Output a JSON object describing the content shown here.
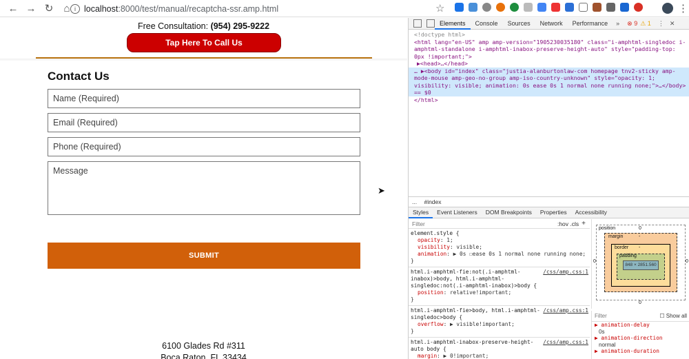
{
  "browser": {
    "url_host": "localhost",
    "url_path": ":8000/test/manual/recaptcha-ssr.amp.html"
  },
  "page": {
    "consult_prefix": "Free Consultation:",
    "consult_phone": "(954) 295-9222",
    "call_button": "Tap Here To Call Us",
    "contact_title": "Contact Us",
    "fields": {
      "name": "Name (Required)",
      "email": "Email (Required)",
      "phone": "Phone (Required)",
      "message": "Message"
    },
    "submit": "SUBMIT",
    "address_line1": "6100 Glades Rd #311",
    "address_line2": "Boca Raton, FL 33434"
  },
  "devtools": {
    "tabs": [
      "Elements",
      "Console",
      "Sources",
      "Network",
      "Performance"
    ],
    "more": "»",
    "errors": "9",
    "warnings": "1",
    "dom": {
      "doctype": "<!doctype html>",
      "html_open": "<html lang=\"en-US\" amp amp-version=\"1905230035180\" class=\"i-amphtml-singledoc i-amphtml-standalone i-amphtml-inabox-preserve-height-auto\" style=\"padding-top: 0px !important;\">",
      "head": "▶<head>…</head>",
      "body": "… ▶<body id=\"index\" class=\"justia-alanburtonlaw-com homepage tnv2-sticky amp-mode-mouse amp-geo-no-group amp-iso-country-unknown\" style=\"opacity: 1; visibility: visible; animation: 0s ease 0s 1 normal none running none;\">…</body> == $0",
      "html_close": "</html>"
    },
    "breadcrumb": [
      "...",
      "#index"
    ],
    "sub_tabs": [
      "Styles",
      "Event Listeners",
      "DOM Breakpoints",
      "Properties",
      "Accessibility"
    ],
    "styles": {
      "filter": "Filter",
      "hov": ":hov .cls",
      "plus": "+",
      "rules": [
        {
          "selector": "element.style {",
          "source": "",
          "props": [
            [
              "opacity",
              "1;"
            ],
            [
              "visibility",
              "visible;"
            ],
            [
              "animation",
              "▶ 0s ☐ease 0s 1 normal none running none;"
            ]
          ]
        },
        {
          "selector": "html.i-amphtml-fie:not(.i-amphtml-inabox)>body, html.i-amphtml-singledoc:not(.i-amphtml-inabox)>body {",
          "source": "/css/amp.css:1",
          "props": [
            [
              "position",
              "relative!important;"
            ]
          ]
        },
        {
          "selector": "html.i-amphtml-fie>body, html.i-amphtml-singledoc>body {",
          "source": "/css/amp.css:1",
          "props": [
            [
              "overflow",
              "▶ visible!important;"
            ]
          ]
        },
        {
          "selector": "html.i-amphtml-inabox-preserve-height-auto body {",
          "source": "/css/amp.css:1",
          "props": [
            [
              "margin",
              "▶ 0!important;"
            ]
          ]
        }
      ]
    },
    "boxmodel": {
      "position": "position",
      "position_val": "0",
      "margin": "margin",
      "margin_val": "-",
      "border": "border",
      "border_val": "-",
      "padding": "padding",
      "padding_val": "-",
      "content": "848 × 2851.560",
      "side_val": "0"
    },
    "computed": {
      "filter": "Filter",
      "show_all": "Show all",
      "items": [
        [
          "animation-delay",
          "0s"
        ],
        [
          "animation-direction",
          "normal"
        ],
        [
          "animation-duration",
          ""
        ]
      ]
    }
  },
  "colors": {
    "call_button": "#cc0000",
    "submit": "#d1600a",
    "divider": "#b8720f"
  }
}
